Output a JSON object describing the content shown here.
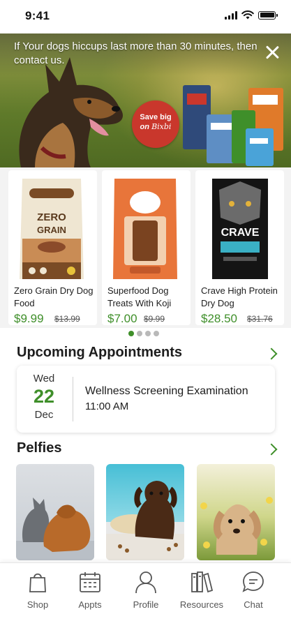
{
  "status_bar": {
    "time": "9:41"
  },
  "banner": {
    "message": "If Your dogs hiccups last more than 30 minutes, then contact us.",
    "promo_line1": "Save big",
    "promo_line2": "on",
    "promo_brand_script": "Bixbi"
  },
  "products": [
    {
      "name": "Zero Grain Dry Dog Food",
      "price": "$9.99",
      "old_price": "$13.99",
      "brand_label": "ZERO GRAIN"
    },
    {
      "name": "Superfood Dog Treats With Koji",
      "price": "$7.00",
      "old_price": "$9.99",
      "brand_label": ""
    },
    {
      "name": "Crave High Protein Dry Dog",
      "price": "$28.50",
      "old_price": "$31.76",
      "brand_label": "CRAVE"
    }
  ],
  "carousel": {
    "pages": 4,
    "active_index": 0
  },
  "appointments": {
    "title": "Upcoming Appointments",
    "items": [
      {
        "weekday": "Wed",
        "day": "22",
        "month": "Dec",
        "title": "Wellness Screening Examination",
        "time": "11:00 AM"
      }
    ]
  },
  "pelfies": {
    "title": "Pelfies"
  },
  "nav": [
    {
      "label": "Shop",
      "icon": "shopping-bag-icon"
    },
    {
      "label": "Appts",
      "icon": "calendar-icon"
    },
    {
      "label": "Profile",
      "icon": "person-icon"
    },
    {
      "label": "Resources",
      "icon": "books-icon"
    },
    {
      "label": "Chat",
      "icon": "chat-bubble-icon"
    }
  ],
  "colors": {
    "accent": "#3f8f2a",
    "promo": "#c9372c",
    "text": "#1d1d1d"
  }
}
